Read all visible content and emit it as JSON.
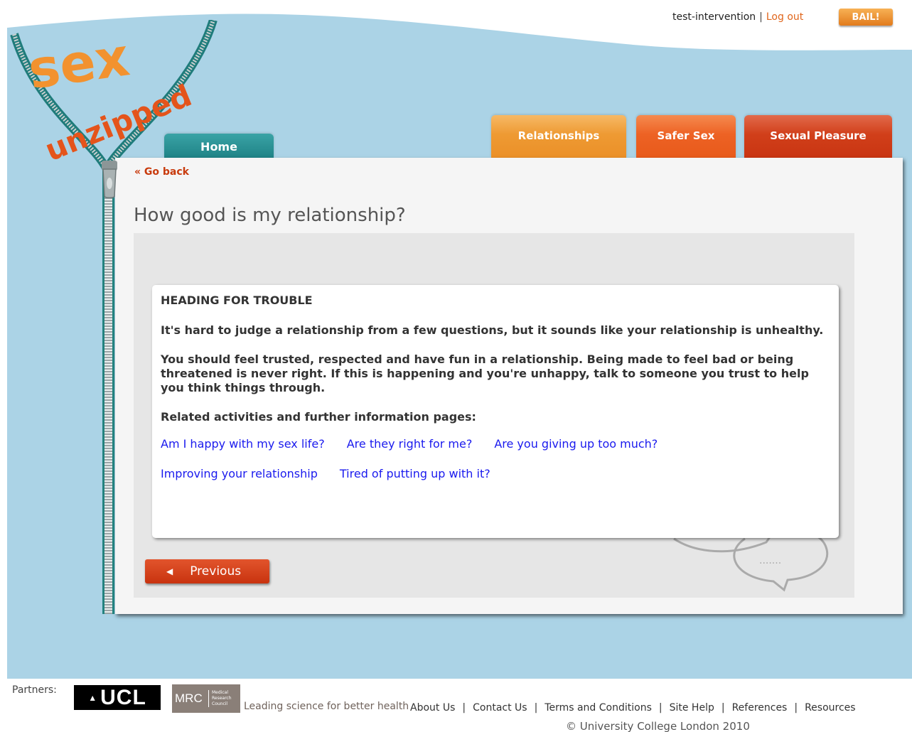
{
  "header": {
    "username": "test-intervention",
    "separator": "|",
    "logout_label": "Log out",
    "bail_label": "BAIL!"
  },
  "logo": {
    "line1": "sex",
    "line2": "unzipped"
  },
  "nav": {
    "home": "Home",
    "relationships": "Relationships",
    "safer_sex": "Safer Sex",
    "sexual_pleasure": "Sexual Pleasure"
  },
  "main": {
    "go_back": "« Go back",
    "page_title": "How good is my relationship?",
    "card": {
      "heading": "HEADING FOR TROUBLE",
      "paragraph1": "It's hard to judge a relationship from a few questions, but it sounds like your relationship is unhealthy.",
      "paragraph2": "You should feel trusted, respected and have fun in a relationship. Being made to feel bad or being threatened is never right. If this is happening and you're unhappy, talk to someone you trust to help you think things through.",
      "related_label": "Related activities and further information pages:",
      "links": [
        "Am I happy with my sex life?",
        "Are they right for me?",
        "Are you giving up too much?",
        "Improving your relationship",
        "Tired of putting up with it?"
      ]
    },
    "previous_label": "Previous",
    "previous_arrow": "◀"
  },
  "footer": {
    "partners_label": "Partners:",
    "ucl_text": "UCL",
    "mrc_text": "MRC",
    "mrc_small": [
      "Medical",
      "Research",
      "Council"
    ],
    "tagline": "Leading science for better health",
    "links": [
      "About Us",
      "Contact Us",
      "Terms and Conditions",
      "Site Help",
      "References",
      "Resources"
    ],
    "link_separator": "|",
    "copyright": "© University College London 2010"
  },
  "colors": {
    "sky": "#abd3e6",
    "teal": "#1f8386",
    "orange": "#eb9028",
    "orange_red": "#e85a1b",
    "red": "#c93512",
    "link_blue": "#1a1aee"
  }
}
